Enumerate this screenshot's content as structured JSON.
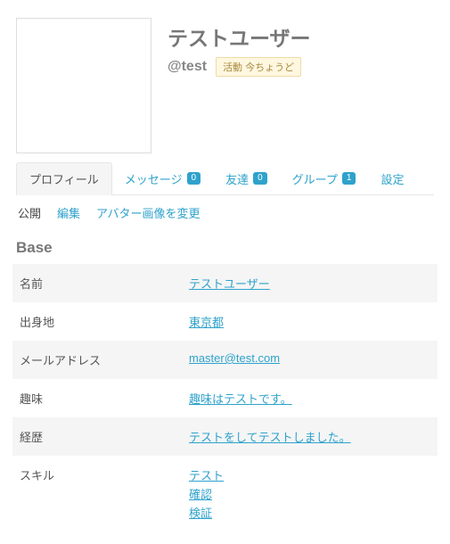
{
  "header": {
    "display_name": "テストユーザー",
    "handle": "@test",
    "activity": "活動 今ちょうど"
  },
  "tabs": {
    "profile": "プロフィール",
    "messages": {
      "label": "メッセージ",
      "count": "0"
    },
    "friends": {
      "label": "友達",
      "count": "0"
    },
    "groups": {
      "label": "グループ",
      "count": "1"
    },
    "settings": "設定"
  },
  "subtabs": {
    "public": "公開",
    "edit": "編集",
    "avatar": "アバター画像を変更"
  },
  "section": {
    "title": "Base",
    "fields": {
      "name": {
        "label": "名前",
        "value": "テストユーザー"
      },
      "origin": {
        "label": "出身地",
        "value": "東京都"
      },
      "email": {
        "label": "メールアドレス",
        "value": "master@test.com"
      },
      "hobby": {
        "label": "趣味",
        "value": "趣味はテストです。"
      },
      "career": {
        "label": "経歴",
        "value": "テストをしてテストしました。"
      },
      "skills": {
        "label": "スキル",
        "values": [
          "テスト",
          "確認",
          "検証"
        ]
      }
    }
  }
}
